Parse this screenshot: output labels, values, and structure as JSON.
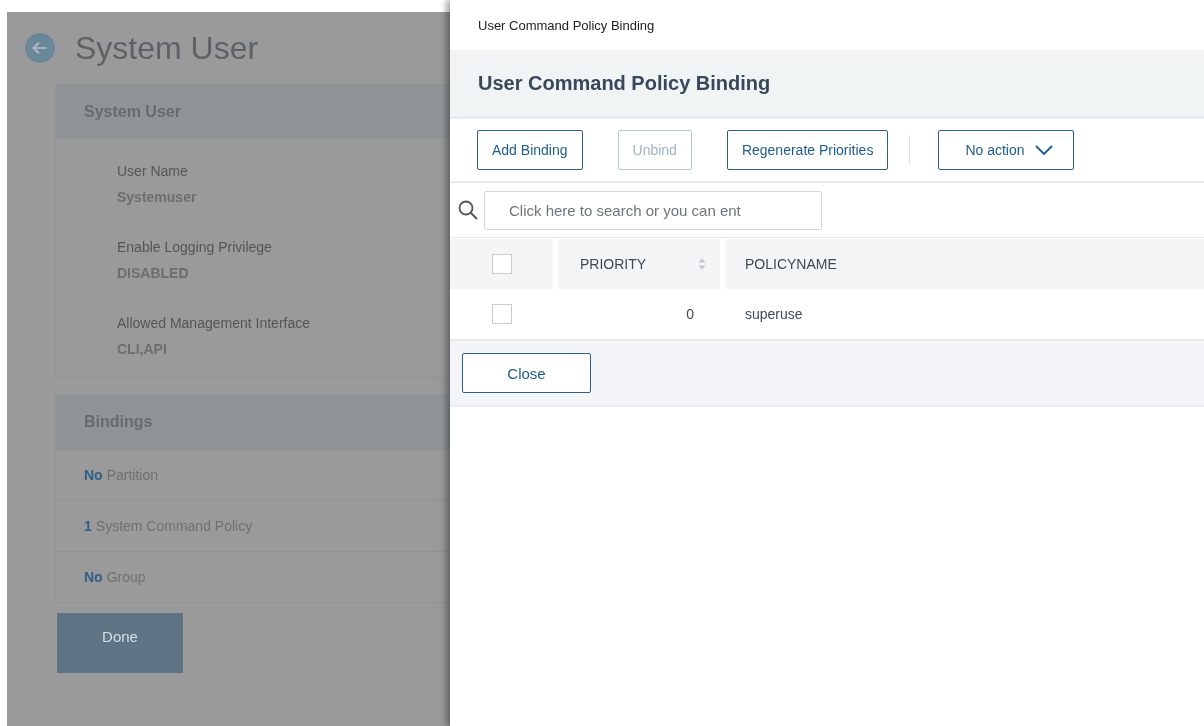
{
  "background_page": {
    "title": "System User",
    "details_card": {
      "title": "System User",
      "fields": [
        {
          "label": "User Name",
          "value": "Systemuser"
        },
        {
          "label": "Enable Logging Privilege",
          "value": "DISABLED"
        },
        {
          "label": "Allowed Management Interface",
          "value": "CLI,API"
        }
      ]
    },
    "bindings_card": {
      "title": "Bindings",
      "items": [
        {
          "count": "No",
          "label": "Partition"
        },
        {
          "count": "1",
          "label": "System Command Policy"
        },
        {
          "count": "No",
          "label": "Group"
        }
      ]
    },
    "done_button": "Done"
  },
  "panel": {
    "breadcrumb": "User Command Policy Binding",
    "title": "User Command Policy Binding",
    "toolbar": {
      "buttons": [
        {
          "label": "Add Binding",
          "disabled": false
        },
        {
          "label": "Unbind",
          "disabled": true
        },
        {
          "label": "Regenerate Priorities",
          "disabled": false
        }
      ],
      "action_dropdown": "No action"
    },
    "search": {
      "placeholder": "Click here to search or you can ent"
    },
    "table": {
      "header_checked": false,
      "columns": [
        "PRIORITY",
        "POLICYNAME"
      ],
      "rows": [
        {
          "checked": false,
          "priority": "0",
          "policyname": "superuse"
        }
      ]
    },
    "close_button": "Close"
  }
}
